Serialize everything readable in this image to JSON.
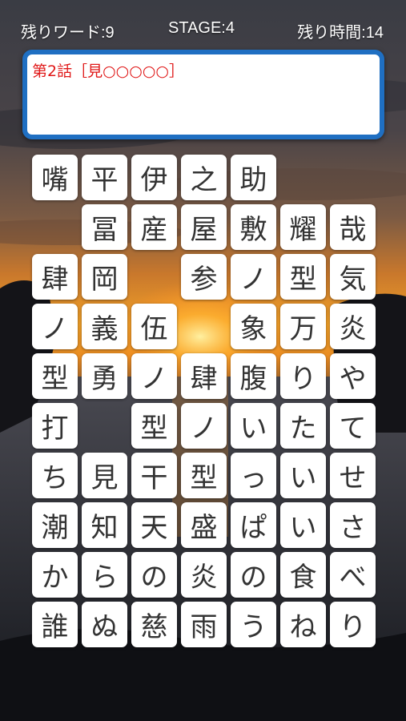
{
  "hud": {
    "words_left": "残りワード:9",
    "stage": "STAGE:4",
    "time_left": "残り時間:14"
  },
  "hint": {
    "text": "第2話［見○○○○○］",
    "color": "#e01818"
  },
  "board": {
    "rows": [
      [
        "嘴",
        "平",
        "伊",
        "之",
        "助",
        "",
        ""
      ],
      [
        "",
        "冨",
        "産",
        "屋",
        "敷",
        "耀",
        "哉"
      ],
      [
        "肆",
        "岡",
        "",
        "参",
        "ノ",
        "型",
        "気"
      ],
      [
        "ノ",
        "義",
        "伍",
        "",
        "象",
        "万",
        "炎"
      ],
      [
        "型",
        "勇",
        "ノ",
        "肆",
        "腹",
        "り",
        "や"
      ],
      [
        "打",
        "",
        "型",
        "ノ",
        "い",
        "た",
        "て"
      ],
      [
        "ち",
        "見",
        "干",
        "型",
        "っ",
        "い",
        "せ"
      ],
      [
        "潮",
        "知",
        "天",
        "盛",
        "ぱ",
        "い",
        "さ"
      ],
      [
        "か",
        "ら",
        "の",
        "炎",
        "の",
        "食",
        "べ"
      ],
      [
        "誰",
        "ぬ",
        "慈",
        "雨",
        "う",
        "ね",
        "り"
      ]
    ]
  },
  "colors": {
    "hint_border": "#1f6fc2",
    "tile_bg": "#ffffff",
    "tile_text": "#333333"
  }
}
